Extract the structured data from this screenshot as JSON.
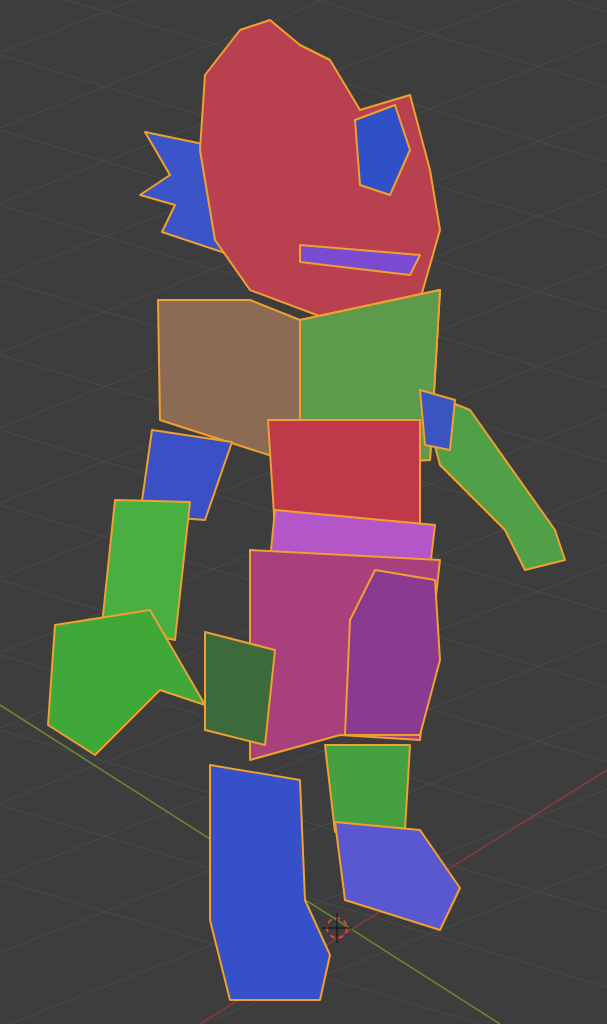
{
  "viewport": {
    "objects": [
      {
        "kind": "character",
        "selected": true
      }
    ]
  }
}
